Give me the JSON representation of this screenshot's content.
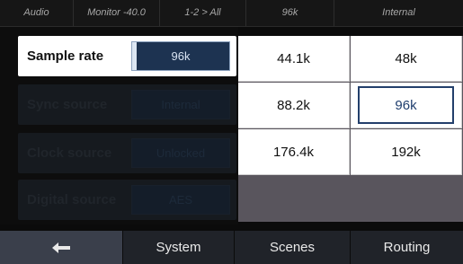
{
  "status_bar": {
    "items": [
      "Audio",
      "Monitor -40.0",
      "1-2 > All",
      "96k",
      "Internal"
    ]
  },
  "settings": {
    "rows": [
      {
        "label": "Sample rate",
        "value": "96k",
        "state": "active"
      },
      {
        "label": "Sync source",
        "value": "Internal",
        "state": "dim"
      },
      {
        "label": "Clock source",
        "value": "Unlocked",
        "state": "dim"
      },
      {
        "label": "Digital source",
        "value": "AES",
        "state": "dim"
      }
    ]
  },
  "sample_rate_options": {
    "options": [
      "44.1k",
      "48k",
      "88.2k",
      "96k",
      "176.4k",
      "192k"
    ],
    "selected": "96k"
  },
  "nav": {
    "back_icon": "back-arrow-icon",
    "system_label": "System",
    "scenes_label": "Scenes",
    "routing_label": "Routing"
  }
}
